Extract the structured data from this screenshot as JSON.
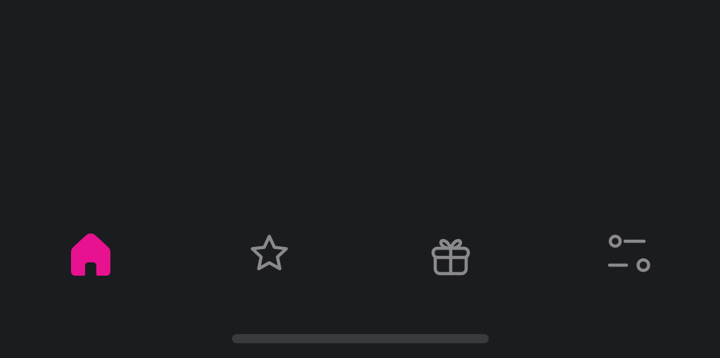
{
  "theme": {
    "background": "#1b1c20",
    "accent": "#e8118f",
    "icon_inactive": "#8a8a8d",
    "home_indicator": "#3a3b3f"
  },
  "tab_bar": {
    "tabs": [
      {
        "id": "home",
        "icon": "house-icon",
        "selected": true
      },
      {
        "id": "favorites",
        "icon": "star-icon",
        "selected": false
      },
      {
        "id": "gifts",
        "icon": "gift-icon",
        "selected": false
      },
      {
        "id": "settings",
        "icon": "sliders-icon",
        "selected": false
      }
    ]
  }
}
